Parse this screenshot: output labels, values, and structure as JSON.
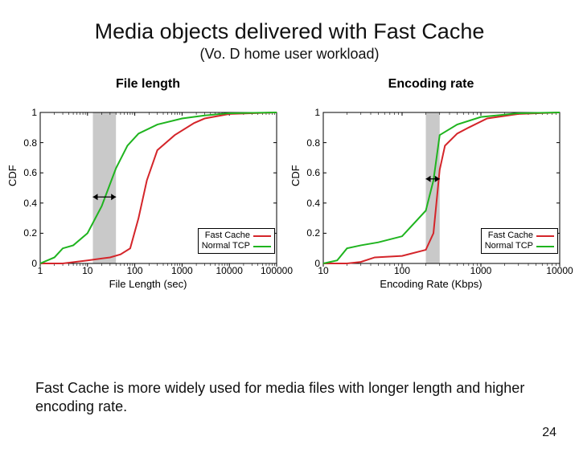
{
  "title": "Media objects delivered with Fast Cache",
  "subtitle": "(Vo. D home user workload)",
  "footnote": "Fast Cache is more widely used for media files with longer length and higher encoding rate.",
  "page_number": "24",
  "legend": {
    "series1": "Fast Cache",
    "series2": "Normal TCP"
  },
  "colors": {
    "fast_cache": "#d4252a",
    "normal_tcp": "#1fb41f",
    "shade": "#c9c9c9",
    "axis": "#000"
  },
  "left_chart_title": "File length",
  "right_chart_title": "Encoding rate",
  "chart_data": [
    {
      "type": "line",
      "title": "File length",
      "xlabel": "File Length (sec)",
      "ylabel": "CDF",
      "xscale": "log",
      "xlim": [
        1,
        100000
      ],
      "ylim": [
        0,
        1
      ],
      "xticks": [
        1,
        10,
        100,
        1000,
        10000,
        100000
      ],
      "yticks": [
        0,
        0.2,
        0.4,
        0.6,
        0.8,
        1
      ],
      "shaded_region_x": [
        13,
        40
      ],
      "annotation_arrow_y": 0.44,
      "series": [
        {
          "name": "Fast Cache",
          "x": [
            1,
            3,
            10,
            30,
            50,
            80,
            120,
            180,
            300,
            700,
            1800,
            3000,
            10000,
            100000
          ],
          "y": [
            0,
            0,
            0.02,
            0.04,
            0.06,
            0.1,
            0.3,
            0.55,
            0.75,
            0.85,
            0.93,
            0.96,
            0.99,
            1.0
          ]
        },
        {
          "name": "Normal TCP",
          "x": [
            1,
            2,
            3,
            5,
            10,
            20,
            40,
            70,
            120,
            300,
            1000,
            3000,
            10000,
            100000
          ],
          "y": [
            0,
            0.04,
            0.1,
            0.12,
            0.2,
            0.38,
            0.63,
            0.78,
            0.86,
            0.92,
            0.96,
            0.98,
            0.995,
            1.0
          ]
        }
      ]
    },
    {
      "type": "line",
      "title": "Encoding rate",
      "xlabel": "Encoding Rate (Kbps)",
      "ylabel": "CDF",
      "xscale": "log",
      "xlim": [
        10,
        10000
      ],
      "ylim": [
        0,
        1
      ],
      "xticks": [
        10,
        100,
        1000,
        10000
      ],
      "yticks": [
        0,
        0.2,
        0.4,
        0.6,
        0.8,
        1
      ],
      "shaded_region_x": [
        200,
        300
      ],
      "annotation_arrow_y": 0.56,
      "series": [
        {
          "name": "Fast Cache",
          "x": [
            10,
            20,
            30,
            45,
            100,
            200,
            250,
            300,
            350,
            500,
            700,
            1200,
            3000,
            10000
          ],
          "y": [
            0,
            0,
            0.01,
            0.04,
            0.05,
            0.09,
            0.2,
            0.62,
            0.78,
            0.86,
            0.9,
            0.96,
            0.99,
            1.0
          ]
        },
        {
          "name": "Normal TCP",
          "x": [
            10,
            15,
            20,
            30,
            50,
            100,
            200,
            250,
            300,
            500,
            1000,
            3000,
            10000
          ],
          "y": [
            0,
            0.02,
            0.1,
            0.12,
            0.14,
            0.18,
            0.35,
            0.55,
            0.85,
            0.92,
            0.97,
            0.995,
            1.0
          ]
        }
      ]
    }
  ]
}
